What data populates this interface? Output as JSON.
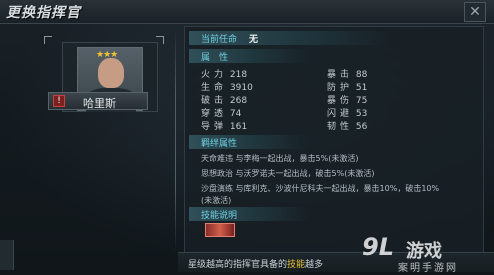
{
  "header": {
    "title": "更换指挥官",
    "close_label": "✕"
  },
  "hero": {
    "name": "哈里斯",
    "stars": "★★★",
    "badge": "!"
  },
  "task": {
    "label": "当前任命",
    "value": "无"
  },
  "attributes": {
    "section_label": "属　性",
    "rows": [
      [
        {
          "k": "火力",
          "v": "218"
        },
        {
          "k": "暴击",
          "v": "88"
        }
      ],
      [
        {
          "k": "生命",
          "v": "3910"
        },
        {
          "k": "防护",
          "v": "51"
        }
      ],
      [
        {
          "k": "破击",
          "v": "268"
        },
        {
          "k": "暴伤",
          "v": "75"
        }
      ],
      [
        {
          "k": "穿透",
          "v": "74"
        },
        {
          "k": "闪避",
          "v": "53"
        }
      ],
      [
        {
          "k": "导弹",
          "v": "161"
        },
        {
          "k": "韧性",
          "v": "56"
        }
      ]
    ]
  },
  "command": {
    "section_label": "羁绊属性",
    "lines": [
      "天命难违 与李梅一起出战，暴击5%(未激活)",
      "思想政治 与沃罗诺夫一起出战，破击5%(未激活)",
      "沙盘演练 与库利克、沙波什尼科夫一起出战，暴击10%，破击10%",
      "(未激活)"
    ]
  },
  "skill": {
    "section_label": "技能说明"
  },
  "footer": {
    "text_pre": "星级越高的指挥官具备的",
    "text_hl": "技能",
    "text_post": "越多"
  },
  "watermark": {
    "num": "9L",
    "cn": "游戏",
    "sub": "案明手游网"
  }
}
